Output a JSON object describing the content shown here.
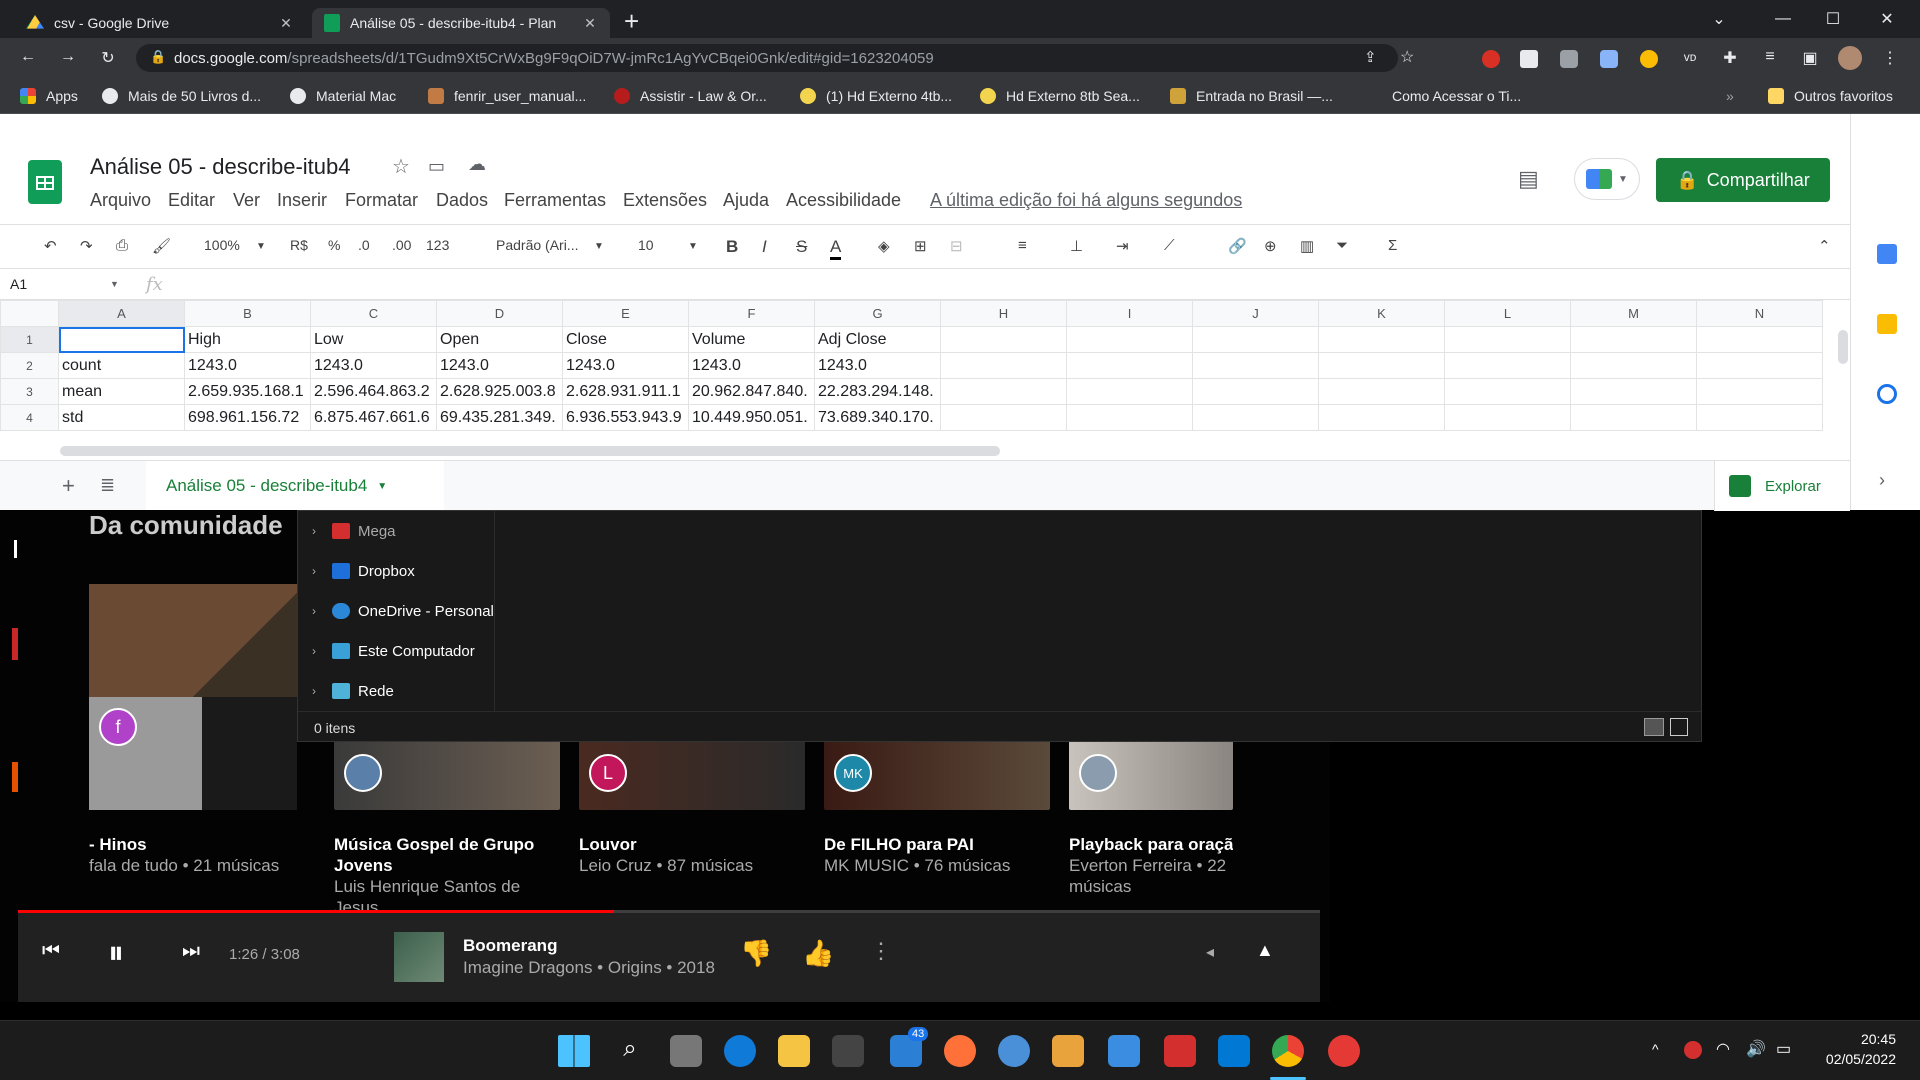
{
  "browser": {
    "tabs": [
      {
        "title": "csv - Google Drive",
        "active": false
      },
      {
        "title": "Análise 05 - describe-itub4 - Plan",
        "active": true
      }
    ],
    "new_tab": "+",
    "url_host": "docs.google.com",
    "url_path": "/spreadsheets/d/1TGudm9Xt5CrWxBg9F9qOiD7W-jmRc1AgYvCBqei0Gnk/edit#gid=1623204059",
    "bookmarks": [
      {
        "label": "Apps",
        "color": "#ea4335"
      },
      {
        "label": "Mais de 50 Livros d...",
        "color": "#e8eaed"
      },
      {
        "label": "Material Mac",
        "color": "#e8eaed"
      },
      {
        "label": "fenrir_user_manual...",
        "color": "#c27b44"
      },
      {
        "label": "Assistir - Law & Or...",
        "color": "#b71c1c"
      },
      {
        "label": "(1) Hd Externo 4tb...",
        "color": "#f2d44e"
      },
      {
        "label": "Hd Externo 8tb Sea...",
        "color": "#f2d44e"
      },
      {
        "label": "Entrada no Brasil —...",
        "color": "#cfa33a"
      },
      {
        "label": "Como Acessar o Ti...",
        "color": "#35363a"
      }
    ],
    "other_bookmarks": "Outros favoritos"
  },
  "sheets": {
    "doc_title": "Análise 05 - describe-itub4",
    "menu": [
      "Arquivo",
      "Editar",
      "Ver",
      "Inserir",
      "Formatar",
      "Dados",
      "Ferramentas",
      "Extensões",
      "Ajuda",
      "Acessibilidade"
    ],
    "last_edit": "A última edição foi há alguns segundos",
    "share_label": "Compartilhar",
    "toolbar": {
      "zoom": "100%",
      "currency": "R$",
      "percent": "%",
      "dec_less": ".0",
      "dec_more": ".00",
      "more_formats": "123",
      "font": "Padrão (Ari...",
      "font_size": "10"
    },
    "name_box": "A1",
    "fx": "fx",
    "columns": [
      "A",
      "B",
      "C",
      "D",
      "E",
      "F",
      "G",
      "H",
      "I",
      "J",
      "K",
      "L",
      "M",
      "N"
    ],
    "rows": [
      {
        "n": "1",
        "cells": [
          "",
          "High",
          "Low",
          "Open",
          "Close",
          "Volume",
          "Adj Close"
        ]
      },
      {
        "n": "2",
        "cells": [
          "count",
          "1243.0",
          "1243.0",
          "1243.0",
          "1243.0",
          "1243.0",
          "1243.0"
        ]
      },
      {
        "n": "3",
        "cells": [
          "mean",
          "2.659.935.168.1",
          "2.596.464.863.2",
          "2.628.925.003.8",
          "2.628.931.911.1",
          "20.962.847.840.",
          "22.283.294.148."
        ]
      },
      {
        "n": "4",
        "cells": [
          "std",
          "698.961.156.72",
          "6.875.467.661.6",
          "69.435.281.349.",
          "6.936.553.943.9",
          "10.449.950.051.",
          "73.689.340.170."
        ]
      }
    ],
    "sheet_tab": "Análise 05 - describe-itub4",
    "explore": "Explorar"
  },
  "ytmusic": {
    "section_title": "Da comunidade",
    "cards": [
      {
        "title": "- Hinos",
        "subtitle": "fala de tudo • 21 músicas",
        "avatar": "f",
        "avatar_color": "#b042c9"
      },
      {
        "title": "Música Gospel de Grupo Jovens",
        "subtitle": "Luis Henrique Santos de Jesus",
        "avatar": "",
        "avatar_color": "#5a7fa8"
      },
      {
        "title": "Louvor",
        "subtitle": "Leio Cruz • 87 músicas",
        "avatar": "L",
        "avatar_color": "#c2185b"
      },
      {
        "title": "De FILHO para PAI",
        "subtitle": "MK MUSIC • 76 músicas",
        "avatar": "MK",
        "avatar_color": "#1e88a8"
      },
      {
        "title": "Playback para oração",
        "subtitle": "Everton Ferreira • 22 músicas",
        "avatar": "",
        "avatar_color": "#8a9cae"
      }
    ],
    "player": {
      "time": "1:26 / 3:08",
      "progress": 0.4574,
      "song": "Boomerang",
      "meta": "Imagine Dragons • Origins • 2018"
    }
  },
  "explorer": {
    "items": [
      {
        "label": "Mega",
        "color": "#d32f2f"
      },
      {
        "label": "Dropbox",
        "color": "#1e6fd9"
      },
      {
        "label": "OneDrive - Personal",
        "color": "#2b88d8"
      },
      {
        "label": "Este Computador",
        "color": "#3aa0d8"
      },
      {
        "label": "Rede",
        "color": "#4fb3d9"
      }
    ],
    "status": "0 itens"
  },
  "taskbar": {
    "mail_badge": "43",
    "time": "20:45",
    "date": "02/05/2022"
  }
}
